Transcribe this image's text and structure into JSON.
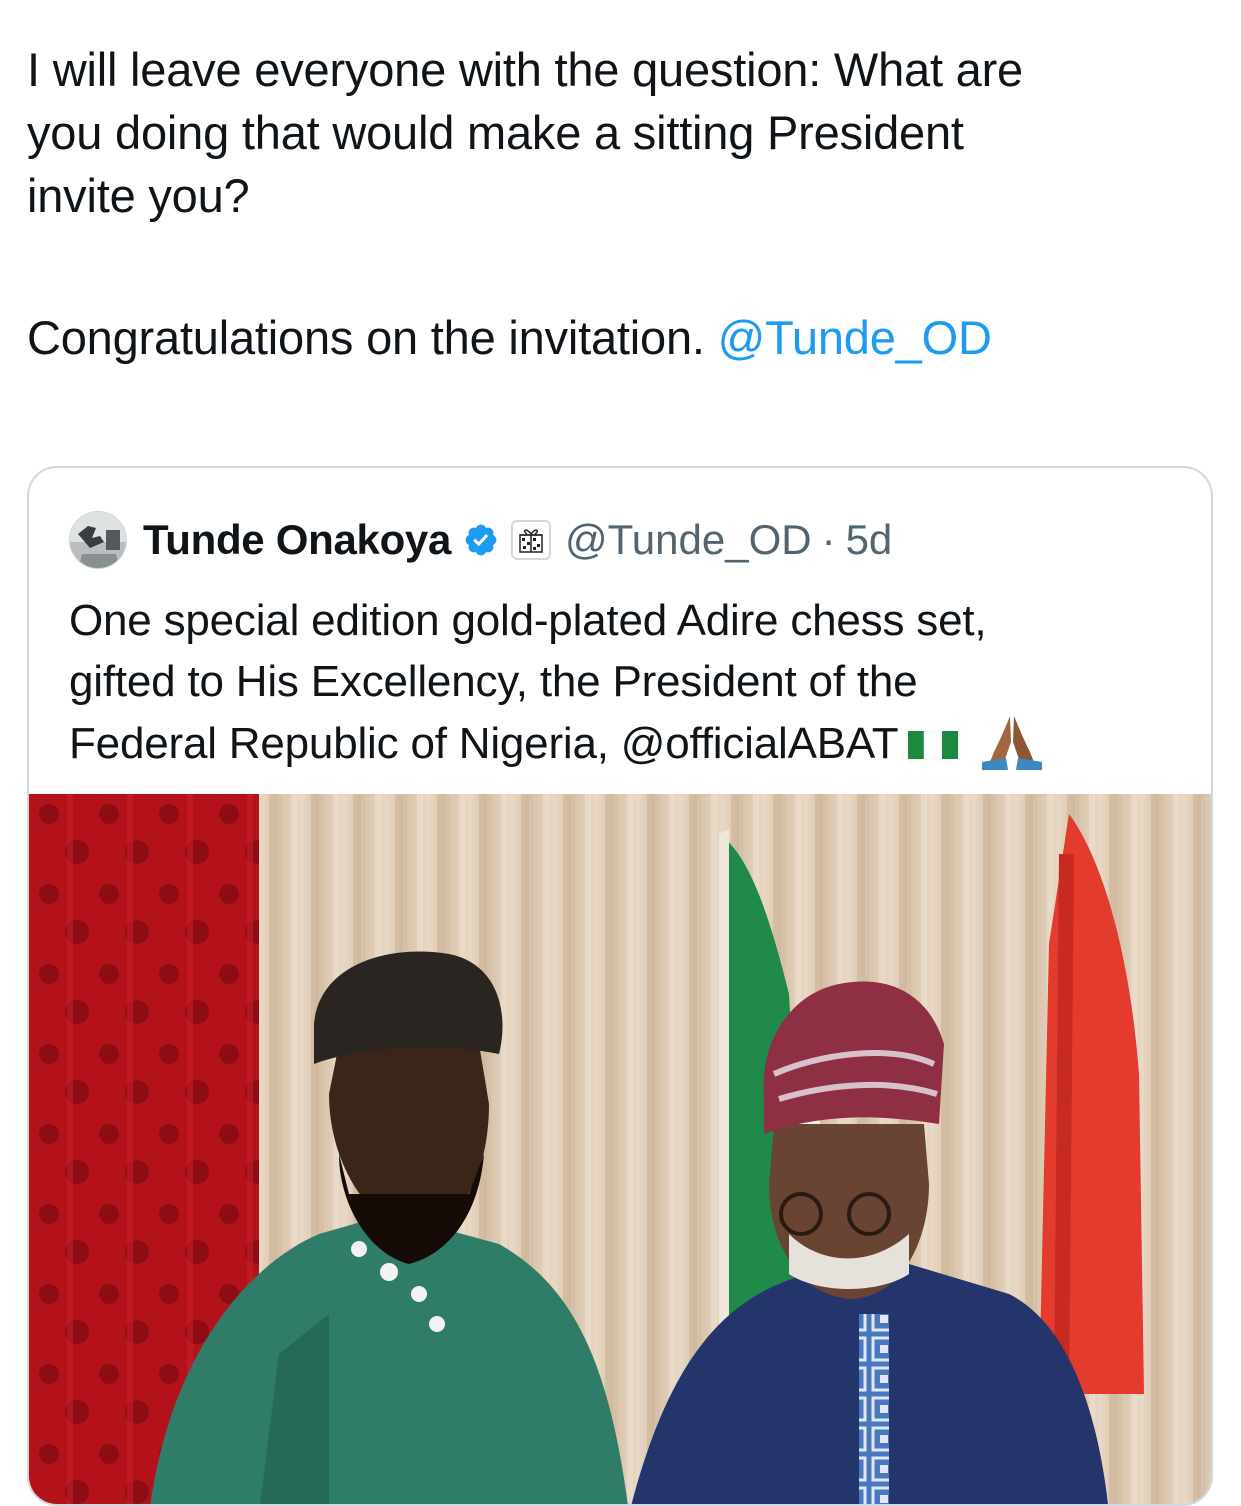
{
  "tweet": {
    "line_1": "I will leave everyone with the question: What are",
    "line_2": "you doing that would make a sitting President",
    "line_3": "invite you?",
    "line_4_text": "Congratulations on the invitation. ",
    "line_4_mention": "@Tunde_OD"
  },
  "quoted_tweet": {
    "author_name": "Tunde Onakoya",
    "handle": "@Tunde_OD",
    "separator": "·",
    "time": "5d",
    "text_line_1": "One special edition gold-plated Adire chess set,",
    "text_line_2": "gifted to His Excellency, the President of the",
    "text_line_3": "Federal Republic of Nigeria, @officialABAT",
    "emojis": [
      "nigeria-flag",
      "folded-hands"
    ],
    "avatar_icon": "avatar-photo",
    "verified_icon": "verified-checkmark",
    "affiliate_icon": "chessboard-gift-badge"
  },
  "colors": {
    "text": "#0f1419",
    "secondary_text": "#536471",
    "link": "#1d9bf0",
    "border": "#cfd9de",
    "verified": "#1d9bf0"
  }
}
